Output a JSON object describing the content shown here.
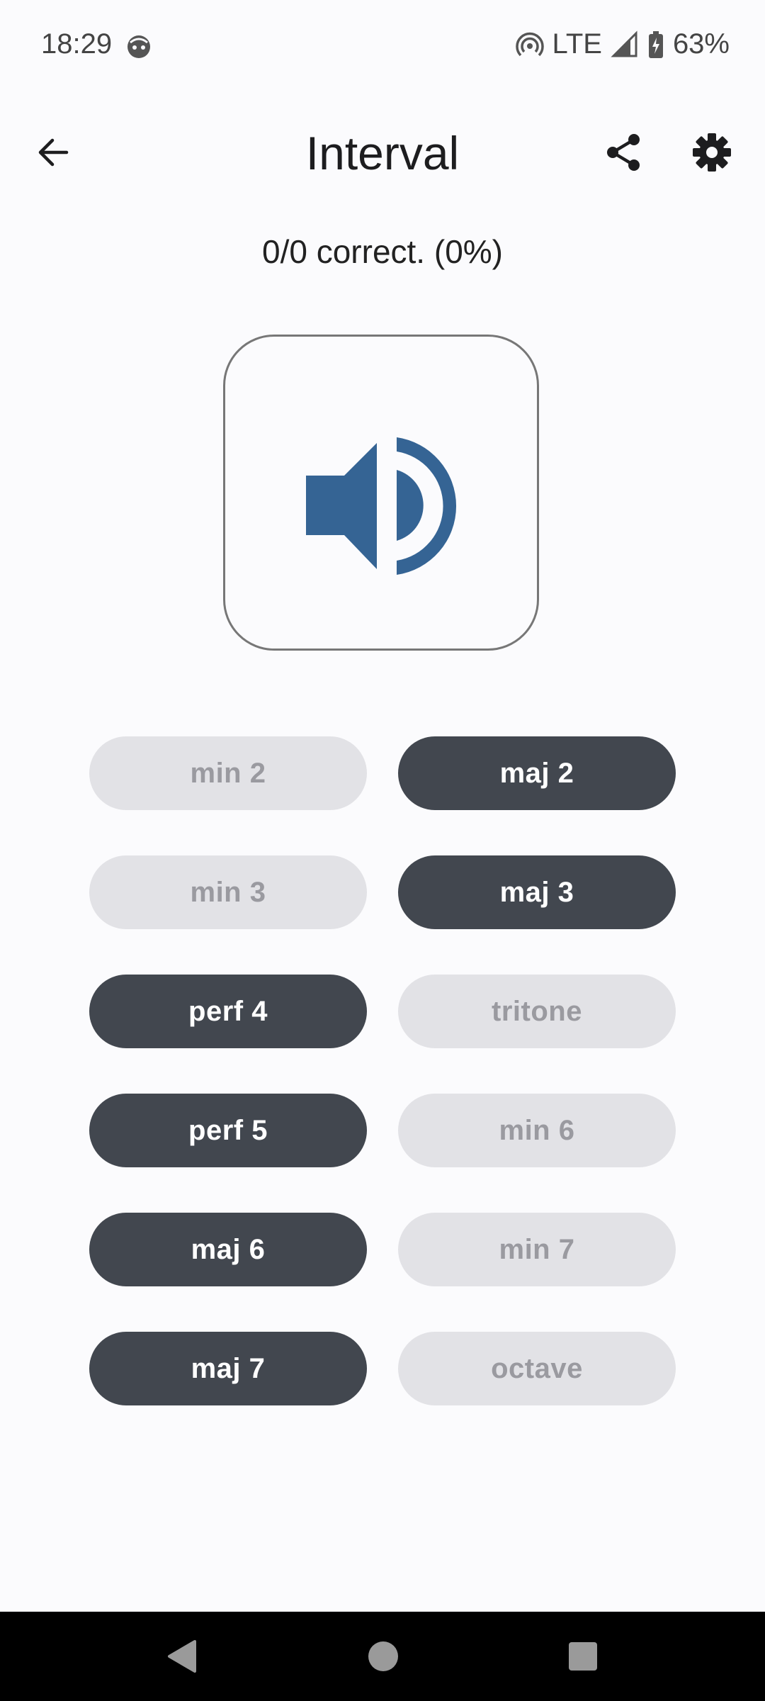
{
  "status": {
    "time": "18:29",
    "network": "LTE",
    "battery": "63%"
  },
  "appbar": {
    "title": "Interval"
  },
  "score": "0/0 correct. (0%)",
  "colors": {
    "accent": "#356494",
    "enabled_bg": "#42474f",
    "disabled_bg": "#e2e2e6",
    "disabled_text": "#9a9aa0"
  },
  "answers": [
    {
      "label": "min 2",
      "enabled": false
    },
    {
      "label": "maj 2",
      "enabled": true
    },
    {
      "label": "min 3",
      "enabled": false
    },
    {
      "label": "maj 3",
      "enabled": true
    },
    {
      "label": "perf 4",
      "enabled": true
    },
    {
      "label": "tritone",
      "enabled": false
    },
    {
      "label": "perf 5",
      "enabled": true
    },
    {
      "label": "min 6",
      "enabled": false
    },
    {
      "label": "maj 6",
      "enabled": true
    },
    {
      "label": "min 7",
      "enabled": false
    },
    {
      "label": "maj 7",
      "enabled": true
    },
    {
      "label": "octave",
      "enabled": false
    }
  ],
  "icons": {
    "back": "arrow-back-icon",
    "share": "share-icon",
    "settings": "gear-icon",
    "play": "speaker-icon"
  }
}
